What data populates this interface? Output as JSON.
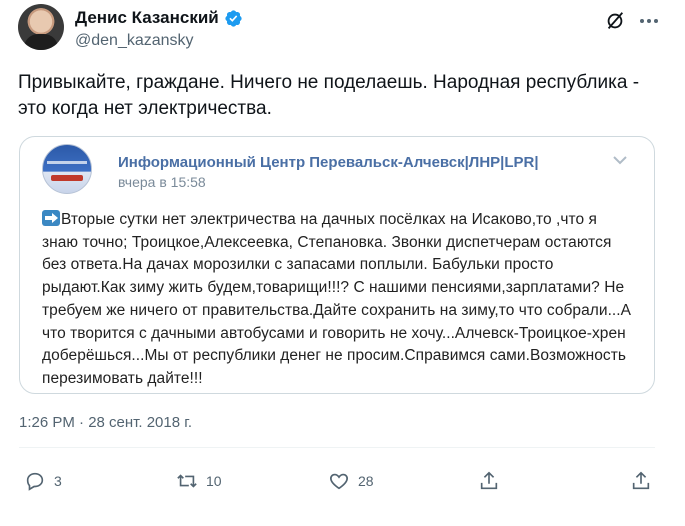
{
  "author": {
    "display_name": "Денис Казанский",
    "handle": "@den_kazansky",
    "verified": true,
    "accent_color": "#1d9bf0"
  },
  "tweet": {
    "text": "Привыкайте, граждане. Ничего не поделаешь. Народная республика - это когда нет электричества.",
    "timestamp": "1:26 PM · 28 сент. 2018 г."
  },
  "quoted_post": {
    "title": "Информационный Центр Перевальск-Алчевск|ЛНР|LPR|",
    "time": "вчера в 15:58",
    "icon": "right-arrow-emoji-icon",
    "body": "Вторые сутки нет электричества на дачных посёлках на Исаково,то ,что я знаю точно; Троицкое,Алексеевка, Степановка. Звонки диспетчерам остаются без ответа.На дачах морозилки с запасами поплыли. Бабульки просто рыдают.Как зиму жить будем,товарищи!!!? С нашими пенсиями,зарплатами? Не требуем же ничего от правительства.Дайте сохранить на зиму,то что собрали...А что творится с дачными автобусами и говорить не хочу...Алчевск-Троицкое-хрен доберёшься...Мы от республики денег не просим.Справимся сами.Возможность перезимовать дайте!!!"
  },
  "actions": {
    "reply_count": "3",
    "retweet_count": "10",
    "like_count": "28"
  }
}
